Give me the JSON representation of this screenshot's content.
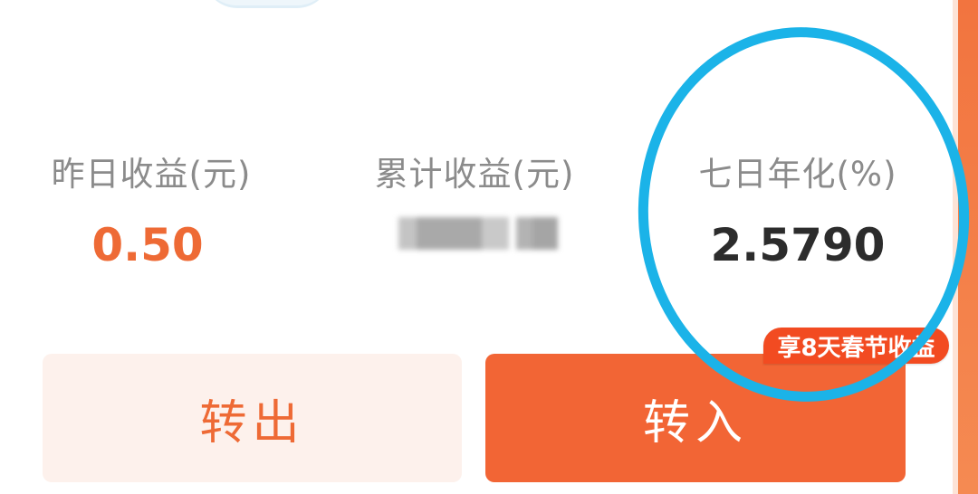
{
  "stats": {
    "yesterday": {
      "label": "昨日收益(元)",
      "value": "0.50"
    },
    "total": {
      "label": "累计收益(元)",
      "value_masked": true
    },
    "apr": {
      "label": "七日年化(%)",
      "value": "2.5790"
    }
  },
  "buttons": {
    "transfer_out": "转出",
    "transfer_in": "转入"
  },
  "promo_badge": "享8天春节收益",
  "colors": {
    "accent_orange": "#ee6a35",
    "button_primary": "#f26535",
    "button_secondary_bg": "#fdf1ec",
    "badge_red": "#f24b21",
    "highlight_ring": "#1bb3e8",
    "label_gray": "#8b8b8b",
    "value_dark": "#2c2c2c"
  }
}
